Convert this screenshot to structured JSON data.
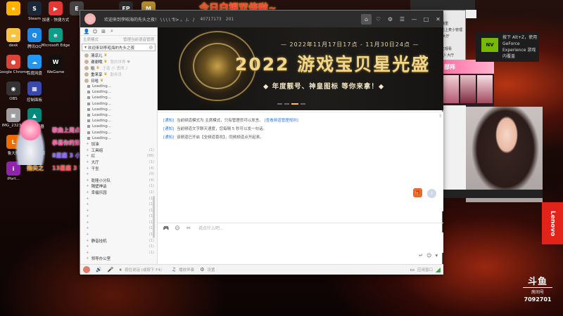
{
  "desktop": {
    "icons": [
      {
        "label": "",
        "color": "#ffb300",
        "glyph": "★"
      },
      {
        "label": "Steam",
        "color": "#1b2838",
        "glyph": "S"
      },
      {
        "label": "加速 - 快捷方式",
        "color": "#e53935",
        "glyph": "▶"
      },
      {
        "label": "",
        "color": "#444444",
        "glyph": "E"
      },
      {
        "label": "EPIC",
        "color": "#2b2b2b",
        "glyph": "EP"
      },
      {
        "label": "",
        "color": "#b08a30",
        "glyph": "M"
      },
      {
        "label": "desk",
        "color": "#f6c343",
        "glyph": "▬"
      },
      {
        "label": "腾讯QQ",
        "color": "#1e88e5",
        "glyph": "Q"
      },
      {
        "label": "Microsoft Edge",
        "color": "#0f9d8a",
        "glyph": "e"
      },
      {
        "label": "Google Chrome",
        "color": "#db4437",
        "glyph": "●"
      },
      {
        "label": "百度网盘",
        "color": "#2196f3",
        "glyph": "☁"
      },
      {
        "label": "WeGame",
        "color": "#111111",
        "glyph": "W"
      },
      {
        "label": "OBS",
        "color": "#333333",
        "glyph": "◉"
      },
      {
        "label": "控制面板",
        "color": "#3949ab",
        "glyph": "▦"
      },
      {
        "label": "IMG_2323...",
        "color": "#9e9e9e",
        "glyph": "▣"
      },
      {
        "label": "游戏加速器",
        "color": "#00897b",
        "glyph": "▲"
      },
      {
        "label": "鲁大师",
        "color": "#ef6c00",
        "glyph": "L"
      },
      {
        "label": "WeGame版",
        "color": "#1565c0",
        "glyph": "W"
      },
      {
        "label": "iPort...",
        "color": "#8e24aa",
        "glyph": "i"
      }
    ],
    "promo_text": "今日白银双倍啦~",
    "overlay_lines": [
      {
        "text": "歌曲上周点歌榜第一名",
        "color": "#ff4fa3"
      },
      {
        "text": "恭喜你的第一名",
        "color": "#ff4fa3"
      },
      {
        "text": "8星座 3 小 入 单",
        "color": "#7a5cff"
      },
      {
        "text": "13星座 3 可中 爆锁 点",
        "color": "#ff4444"
      },
      {
        "text": "指尖之",
        "color": "#ff9f1a"
      }
    ]
  },
  "app": {
    "title": "欢迎来到李昭海的先头之夜！ \\ \\ \\ \\ 'f/> 。 /、 /",
    "room_id": "40717173",
    "viewer_count": "201",
    "titlebar_buttons": [
      "⌂",
      "♡",
      "⚙",
      "☰",
      "—",
      "□",
      "✕"
    ],
    "sidebar": {
      "tab_icons": [
        "👤",
        "☺",
        "⊞",
        "⌕"
      ],
      "mode_label": "主席模式",
      "manage_label": "管理当前语音管理",
      "channel": "欢迎来到李昭海的先头之夜",
      "channel_icon": "◎",
      "users": [
        {
          "name": "清凉儿",
          "badge": "♛",
          "dim": ""
        },
        {
          "name": "谢谢哦",
          "badge": "♛",
          "dim": "我的世界 ♥"
        },
        {
          "name": "姐",
          "badge": "♛",
          "dim": "王者 小 勇闯 ♪"
        },
        {
          "name": "重来享",
          "badge": "♛",
          "dim": "勤务员"
        },
        {
          "name": "日哈",
          "badge": "♛",
          "dim": ""
        }
      ],
      "loading_label": "Loading...",
      "loading_count": 10,
      "channel_list": [
        {
          "name": "加油",
          "count": ""
        },
        {
          "name": "工具组",
          "count": "(1)"
        },
        {
          "name": "红",
          "count": "(98)"
        },
        {
          "name": "大厅",
          "count": "(1)"
        },
        {
          "name": "干坐",
          "count": "(4)"
        },
        {
          "name": "",
          "count": "(0)"
        },
        {
          "name": "乾隆小分队",
          "count": "(4)"
        },
        {
          "name": "隔壁神话",
          "count": "(1)"
        },
        {
          "name": "幸福乐园",
          "count": "(1)"
        },
        {
          "name": "",
          "count": "(1)"
        },
        {
          "name": "",
          "count": "(1)"
        },
        {
          "name": "",
          "count": "(1)"
        },
        {
          "name": "",
          "count": "(1)"
        },
        {
          "name": "",
          "count": "(1)"
        },
        {
          "name": "",
          "count": "(1)"
        },
        {
          "name": "",
          "count": "(1)"
        },
        {
          "name": "静音挂机",
          "count": "(1)"
        },
        {
          "name": "",
          "count": "(1)"
        },
        {
          "name": "",
          "count": "(1)"
        }
      ],
      "footer": "领导办公室"
    },
    "banner": {
      "date_text": "— 2022年11月17日17点 - 11月30日24点 —",
      "title": "2022 游戏宝贝星光盛",
      "subtitle": "◆ 年度靓号、神皇图标 等你来拿！◆"
    },
    "notices": [
      {
        "tag": "[通知]",
        "text": "当前频道模式为 主席模式，只有管理员可以发言。",
        "link": "[查看频道管理规则]"
      },
      {
        "tag": "[通知]",
        "text": "当前频道文字聊天速度，您每隔 5 秒可以发一句话。",
        "link": ""
      },
      {
        "tag": "[通知]",
        "text": "该频道已开启【全频道喜欢】，同频频道点开起来。",
        "link": ""
      }
    ],
    "input": {
      "placeholder": "说点什么吧...",
      "toolbar_icons": [
        "🎮",
        "☺",
        "✂"
      ],
      "send_icons": [
        "↵",
        "☺",
        "▾"
      ]
    },
    "bottombar": {
      "icons": [
        "🔊",
        "🎤",
        "⏸"
      ],
      "input_text": "按住说话 (或按下 F4)",
      "music_label": "播放伴奏",
      "settings_label": "设置",
      "app_label": "应用窗口",
      "center_icon": "⚙"
    }
  },
  "right_side": {
    "notif_title": "按下 Alt+Z，使用 GeForce Experience 游戏内覆盖",
    "notif_icon": "NV",
    "side_rows": [
      "主播重",
      "点击上麦小管理",
      "分 大厅",
      "头",
      "点击观看",
      "乐 小 大厅"
    ],
    "preview_banner": "部阵",
    "top_right_label": "声音器",
    "lenovo": "Lenovo",
    "douyu_brand": "斗鱼",
    "douyu_sub": "房间号",
    "douyu_room": "7092701"
  }
}
